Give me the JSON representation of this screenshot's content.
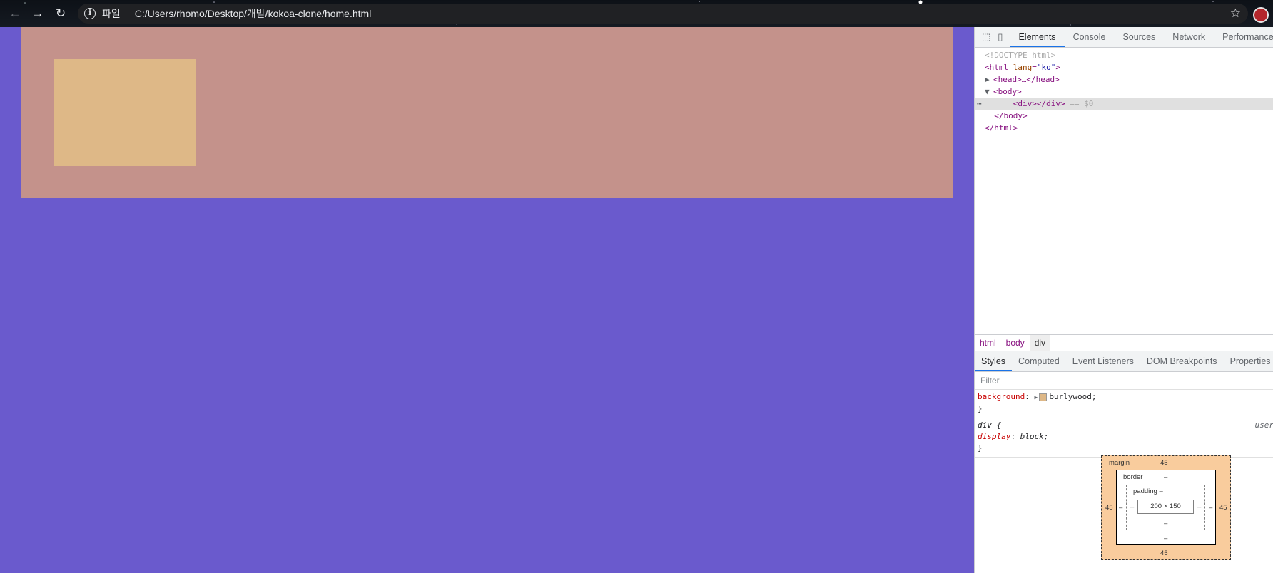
{
  "browser": {
    "omnibox_label": "파일",
    "url": "C:/Users/rhomo/Desktop/개발/kokoa-clone/home.html"
  },
  "devtools": {
    "tabs": [
      "Elements",
      "Console",
      "Sources",
      "Network",
      "Performance"
    ],
    "active_tab": "Elements",
    "dom": {
      "doctype": "<!DOCTYPE html>",
      "html_open_tag": "<html",
      "html_attr_name": "lang",
      "html_attr_value": "\"ko\"",
      "html_open_close": ">",
      "head": "<head>…</head>",
      "body_open": "<body>",
      "div_line": "<div></div>",
      "div_marker": "== $0",
      "body_close": "</body>",
      "html_close": "</html>"
    },
    "breadcrumbs": [
      "html",
      "body",
      "div"
    ],
    "sub_tabs": [
      "Styles",
      "Computed",
      "Event Listeners",
      "DOM Breakpoints",
      "Properties"
    ],
    "filter_placeholder": "Filter",
    "styles": {
      "rule1_prop": "background",
      "rule1_value": "burlywood;",
      "rule2_selector": "div {",
      "rule2_prop": "display",
      "rule2_value": "block;",
      "rule2_source": "user",
      "close_brace": "}"
    },
    "box_model": {
      "margin_label": "margin",
      "margin_top": "45",
      "margin_bottom": "45",
      "margin_left": "45",
      "margin_right": "45",
      "border_label": "border",
      "border_top": "–",
      "border_bottom": "–",
      "border_left": "–",
      "border_right": "–",
      "padding_label": "padding –",
      "padding_bottom": "–",
      "padding_left": "–",
      "padding_right": "–",
      "content_size": "200 × 150"
    }
  },
  "colors": {
    "page_background": "#6a5acd",
    "outer_div": "#c4928b",
    "inner_div": "#deb887"
  }
}
